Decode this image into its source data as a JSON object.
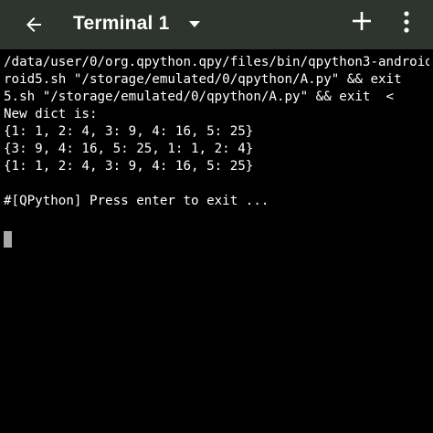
{
  "toolbar": {
    "title": "Terminal 1",
    "icons": {
      "back": "arrow-back-icon",
      "dropdown": "dropdown-triangle-icon",
      "add": "plus-icon",
      "menu": "more-vert-icon"
    },
    "background_color": "#2e342e"
  },
  "terminal": {
    "lines": [
      "/data/user/0/org.qpython.qpy/files/bin/qpython3-android5.sh \"/storage/emulated/0/qpython/A.py\" && exit",
      "roid5.sh \"/storage/emulated/0/qpython/A.py\" && exit",
      "5.sh \"/storage/emulated/0/qpython/A.py\" && exit  <",
      "New dict is:",
      "{1: 1, 2: 4, 3: 9, 4: 16, 5: 25}",
      "{3: 9, 4: 16, 5: 25, 1: 1, 2: 4}",
      "{1: 1, 2: 4, 3: 9, 4: 16, 5: 25}",
      "",
      "#[QPython] Press enter to exit ..."
    ],
    "text_color": "#ffffff",
    "background_color": "#000000",
    "cursor_color": "#a8a8a8"
  }
}
